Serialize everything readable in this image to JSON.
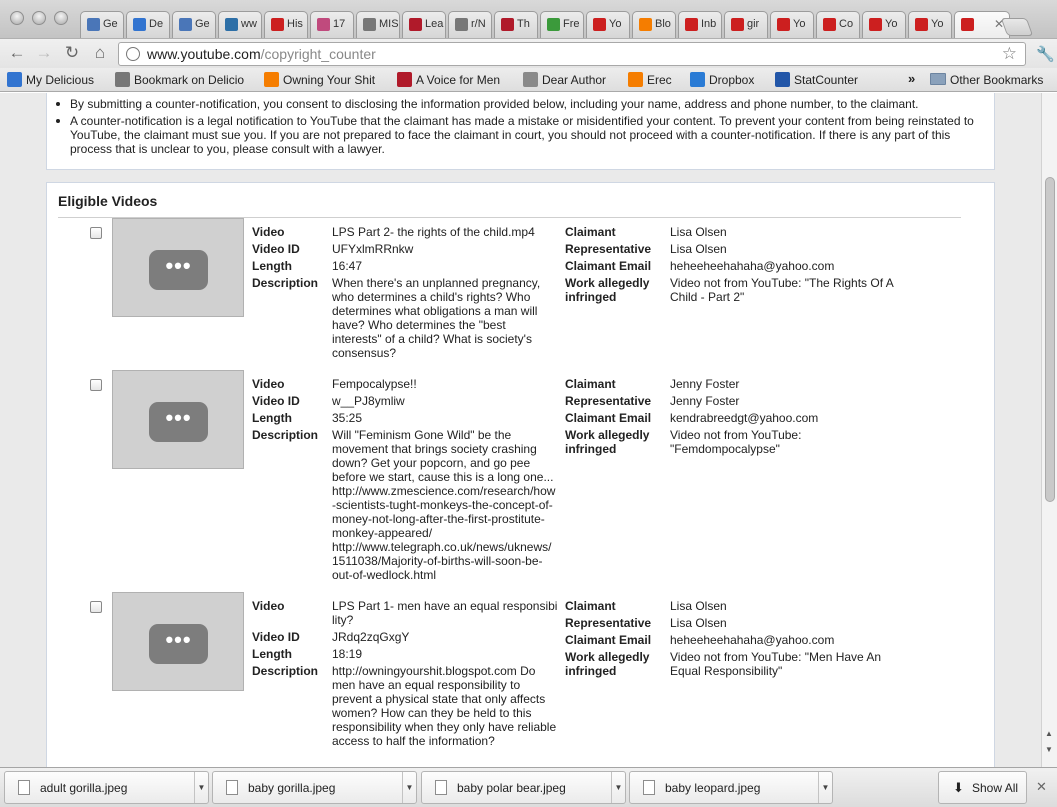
{
  "tabs": [
    {
      "label": "Ge",
      "icon": "google-icon",
      "color": "#4a76b8"
    },
    {
      "label": "De",
      "icon": "delicious-icon",
      "color": "#3274d0"
    },
    {
      "label": "Ge",
      "icon": "google-icon",
      "color": "#4a76b8"
    },
    {
      "label": "ww",
      "icon": "wordpress-icon",
      "color": "#2d6fa7"
    },
    {
      "label": "His",
      "icon": "youtube-icon",
      "color": "#cc1f1f"
    },
    {
      "label": "17",
      "icon": "flower-icon",
      "color": "#c04a7d"
    },
    {
      "label": "MIS",
      "icon": "globe-icon",
      "color": "#777777"
    },
    {
      "label": "Lea",
      "icon": "avfm-icon",
      "color": "#b01a2a"
    },
    {
      "label": "r/N",
      "icon": "globe-icon",
      "color": "#777777"
    },
    {
      "label": "Th",
      "icon": "avfm-icon",
      "color": "#b01a2a"
    },
    {
      "label": "Fre",
      "icon": "leaf-icon",
      "color": "#3b9a3b"
    },
    {
      "label": "Yo",
      "icon": "youtube-icon",
      "color": "#cc1f1f"
    },
    {
      "label": "Blo",
      "icon": "blogger-icon",
      "color": "#f57d00"
    },
    {
      "label": "Inb",
      "icon": "youtube-icon",
      "color": "#cc1f1f"
    },
    {
      "label": "gir",
      "icon": "youtube-icon",
      "color": "#cc1f1f"
    },
    {
      "label": "Yo",
      "icon": "youtube-icon",
      "color": "#cc1f1f"
    },
    {
      "label": "Co",
      "icon": "youtube-icon",
      "color": "#cc1f1f"
    },
    {
      "label": "Yo",
      "icon": "youtube-icon",
      "color": "#cc1f1f"
    },
    {
      "label": "Yo",
      "icon": "youtube-icon",
      "color": "#cc1f1f"
    },
    {
      "label": "",
      "icon": "youtube-icon",
      "color": "#cc1f1f",
      "active": true
    }
  ],
  "address": {
    "host": "www.youtube.com",
    "path": "/copyright_counter"
  },
  "bookmarks": [
    {
      "label": "My Delicious",
      "icon": "delicious-icon",
      "color": "#3274d0"
    },
    {
      "label": "Bookmark on Delicio",
      "icon": "globe-icon",
      "color": "#777777"
    },
    {
      "label": "Owning Your Shit",
      "icon": "blogger-icon",
      "color": "#f57d00"
    },
    {
      "label": "A Voice for Men",
      "icon": "avfm-icon",
      "color": "#b01a2a"
    },
    {
      "label": "Dear Author",
      "icon": "page-icon",
      "color": "#8a8a8a"
    },
    {
      "label": "Erec",
      "icon": "blogger-icon",
      "color": "#f57d00"
    },
    {
      "label": "Dropbox",
      "icon": "dropbox-icon",
      "color": "#2a7bd5"
    },
    {
      "label": "StatCounter",
      "icon": "statcounter-icon",
      "color": "#2256a8"
    }
  ],
  "bookmarks_more": "»",
  "other_bookmarks": "Other Bookmarks",
  "notice": [
    "By submitting a counter-notification, you consent to disclosing the information provided below, including your name, address and phone number, to the claimant.",
    "A counter-notification is a legal notification to YouTube that the claimant has made a mistake or misidentified your content. To prevent your content from being reinstated to YouTube, the claimant must sue you. If you are not prepared to face the claimant in court, you should not proceed with a counter-notification. If there is any part of this process that is unclear to you, please consult with a lawyer."
  ],
  "eligible_title": "Eligible Videos",
  "field_labels": {
    "video": "Video",
    "video_id": "Video ID",
    "length": "Length",
    "description": "Description",
    "claimant": "Claimant",
    "representative": "Representative",
    "claimant_email": "Claimant Email",
    "work_infringed": "Work allegedly infringed"
  },
  "thumbnail_placeholder": "•••",
  "videos": [
    {
      "title": "LPS Part 2- the rights of the child.mp4",
      "video_id": "UFYxlmRRnkw",
      "length": "16:47",
      "description": "When there's an unplanned pregnancy, who determines a child's rights? Who determines what obligations a man will have? Who determines the \"best interests\" of a child? What is society's consensus?",
      "claimant": "Lisa Olsen",
      "representative": "Lisa Olsen",
      "claimant_email": "heheeheehahaha@yahoo.com",
      "work_infringed": "Video not from YouTube: \"The Rights Of A Child - Part 2\"",
      "checked": false
    },
    {
      "title": "Fempocalypse!!",
      "video_id": "w__PJ8ymliw",
      "length": "35:25",
      "description": "Will \"Feminism Gone Wild\" be the movement that brings society crashing down? Get your popcorn, and go pee before we start, cause this is a long one... http://www.zmescience.com/research/how-scientists-tught-monkeys-the-concept-of-money-not-long-after-the-first-prostitute-monkey-appeared/ http://www.telegraph.co.uk/news/uknews/1511038/Majority-of-births-will-soon-be-out-of-wedlock.html",
      "claimant": "Jenny Foster",
      "representative": "Jenny Foster",
      "claimant_email": "kendrabreedgt@yahoo.com",
      "work_infringed": "Video not from YouTube: \"Femdompocalypse\"",
      "checked": false
    },
    {
      "title": "LPS Part 1- men have an equal responsibility?",
      "video_id": "JRdq2zqGxgY",
      "length": "18:19",
      "description": "http://owningyourshit.blogspot.com Do men have an equal responsibility to prevent a physical state that only affects women? How can they be held to this responsibility when they only have reliable access to half the information?",
      "claimant": "Lisa Olsen",
      "representative": "Lisa Olsen",
      "claimant_email": "heheeheehahaha@yahoo.com",
      "work_infringed": "Video not from YouTube: \"Men Have An Equal Responsibility\"",
      "checked": false
    }
  ],
  "downloads": [
    "adult gorilla.jpeg",
    "baby gorilla.jpeg",
    "baby polar bear.jpeg",
    "baby leopard.jpeg"
  ],
  "show_all": "Show All"
}
